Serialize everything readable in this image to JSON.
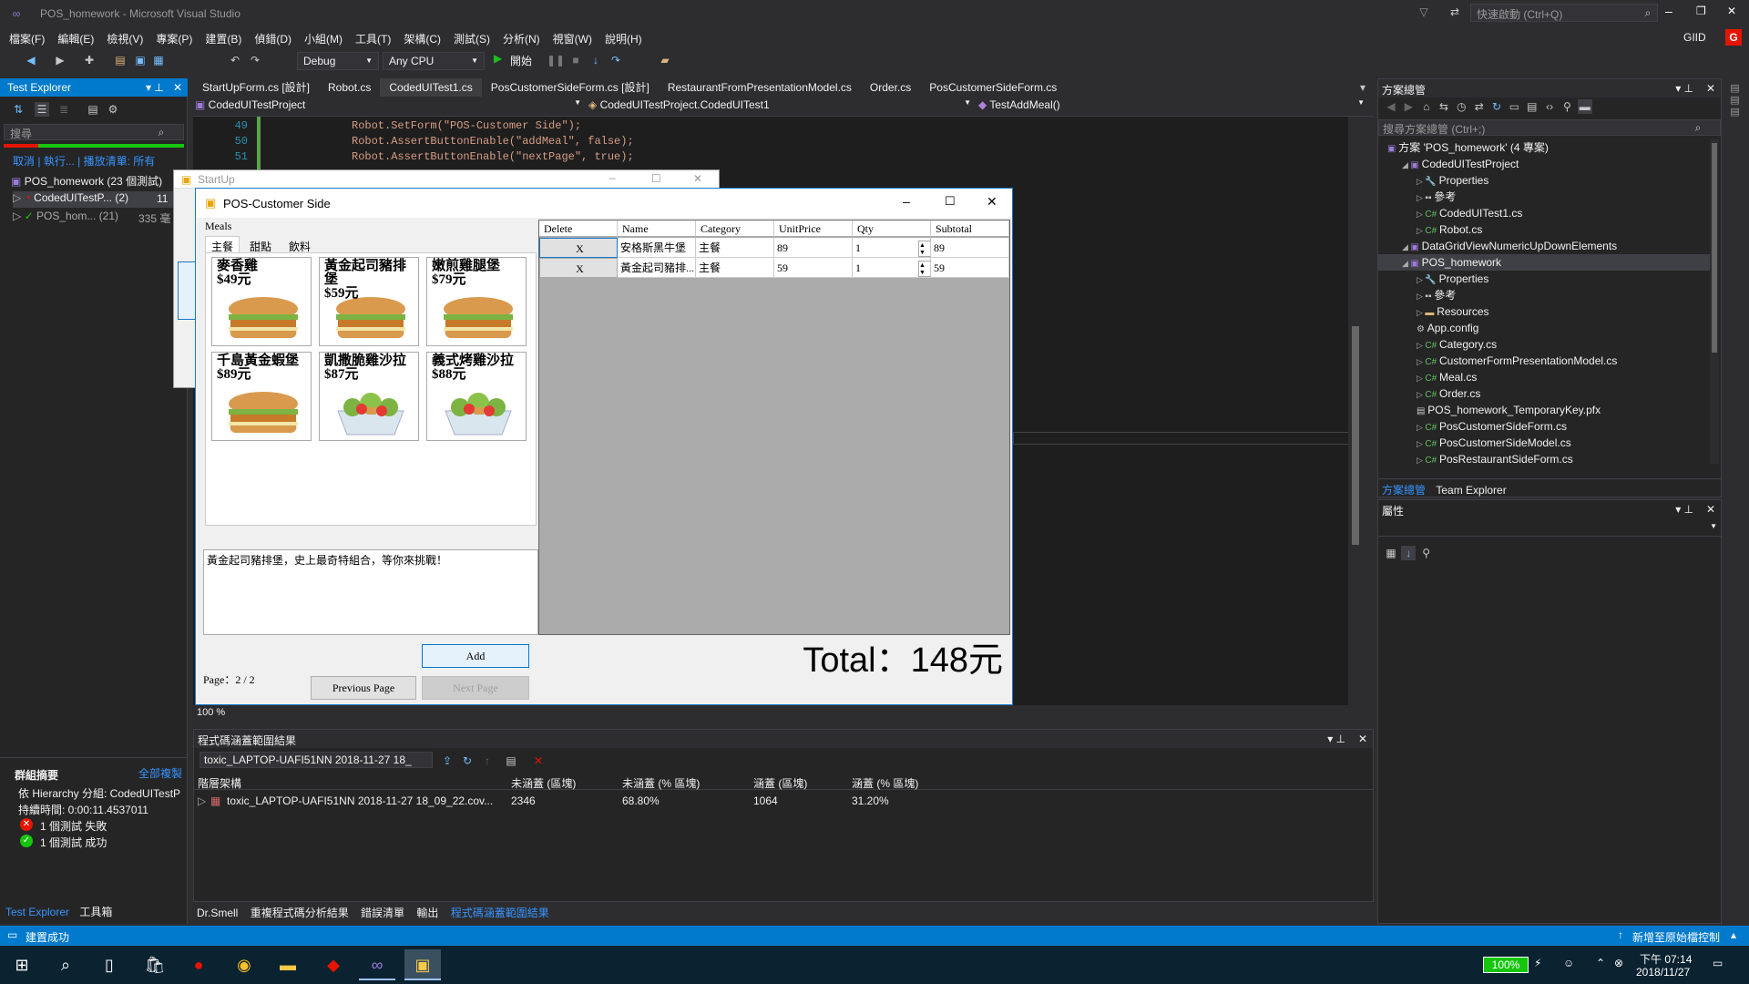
{
  "vs": {
    "title": "POS_homework - Microsoft Visual Studio",
    "quick_launch": "快速啟動 (Ctrl+Q)",
    "user": "GIID",
    "user_initial": "G",
    "menu": [
      "檔案(F)",
      "編輯(E)",
      "檢視(V)",
      "專案(P)",
      "建置(B)",
      "偵錯(D)",
      "小組(M)",
      "工具(T)",
      "架構(C)",
      "測試(S)",
      "分析(N)",
      "視窗(W)",
      "說明(H)"
    ],
    "config": "Debug",
    "platform": "Any CPU",
    "start": "開始"
  },
  "test_explorer": {
    "title": "Test Explorer",
    "search_placeholder": "搜尋",
    "actions": [
      "取消",
      "執行...",
      "播放清單: 所有"
    ],
    "group": "POS_homework (23 個測試)",
    "tests": [
      {
        "name": "CodedUITestP... (2)",
        "count": "11"
      },
      {
        "name": "POS_hom... (21)",
        "count": "335 毫"
      }
    ],
    "summary_title": "群組摘要",
    "copy_all": "全部複製",
    "hierarchy": "依 Hierarchy 分組: CodedUITestP",
    "duration": "持續時間: 0:00:11.4537011",
    "failed": "1 個測試 失敗",
    "passed": "1 個測試 成功",
    "bottom_tabs": [
      "Test Explorer",
      "工具箱"
    ]
  },
  "editor": {
    "tabs": [
      "StartUpForm.cs [設計]",
      "Robot.cs",
      "CodedUITest1.cs",
      "PosCustomerSideForm.cs [設計]",
      "RestaurantFromPresentationModel.cs",
      "Order.cs",
      "PosCustomerSideForm.cs"
    ],
    "nav": [
      "CodedUITestProject",
      "CodedUITestProject.CodedUITest1",
      "TestAddMeal()"
    ],
    "lines": [
      {
        "n": "49",
        "code": "Robot.SetForm(\"POS-Customer Side\");"
      },
      {
        "n": "50",
        "code": "Robot.AssertButtonEnable(\"addMeal\", false);"
      },
      {
        "n": "51",
        "code": "Robot.AssertButtonEnable(\"nextPage\", true);"
      }
    ],
    "zoom": "100 %"
  },
  "coverage": {
    "title": "程式碼涵蓋範圍結果",
    "run": "toxic_LAPTOP-UAFI51NN 2018-11-27 18_",
    "headers": [
      "階層架構",
      "未涵蓋 (區塊)",
      "未涵蓋 (% 區塊)",
      "涵蓋 (區塊)",
      "涵蓋 (% 區塊)"
    ],
    "row": [
      "toxic_LAPTOP-UAFI51NN 2018-11-27 18_09_22.cov...",
      "2346",
      "68.80%",
      "1064",
      "31.20%"
    ]
  },
  "bottom_tabs": [
    "Dr.Smell",
    "重複程式碼分析結果",
    "錯誤清單",
    "輸出",
    "程式碼涵蓋範圍結果"
  ],
  "solution": {
    "title": "方案總管",
    "search": "搜尋方案總管 (Ctrl+;)",
    "items": [
      {
        "label": "方案 'POS_homework' (4 專案)",
        "indent": 0,
        "icon": "solution"
      },
      {
        "label": "CodedUITestProject",
        "indent": 1,
        "icon": "project"
      },
      {
        "label": "Properties",
        "indent": 2,
        "icon": "wrench"
      },
      {
        "label": "參考",
        "indent": 2,
        "icon": "ref"
      },
      {
        "label": "CodedUITest1.cs",
        "indent": 2,
        "icon": "cs"
      },
      {
        "label": "Robot.cs",
        "indent": 2,
        "icon": "cs"
      },
      {
        "label": "DataGridViewNumericUpDownElements",
        "indent": 1,
        "icon": "project"
      },
      {
        "label": "POS_homework",
        "indent": 1,
        "icon": "project",
        "selected": true
      },
      {
        "label": "Properties",
        "indent": 2,
        "icon": "wrench"
      },
      {
        "label": "參考",
        "indent": 2,
        "icon": "ref"
      },
      {
        "label": "Resources",
        "indent": 2,
        "icon": "folder"
      },
      {
        "label": "App.config",
        "indent": 2,
        "icon": "config"
      },
      {
        "label": "Category.cs",
        "indent": 2,
        "icon": "cs"
      },
      {
        "label": "CustomerFormPresentationModel.cs",
        "indent": 2,
        "icon": "cs"
      },
      {
        "label": "Meal.cs",
        "indent": 2,
        "icon": "cs"
      },
      {
        "label": "Order.cs",
        "indent": 2,
        "icon": "cs"
      },
      {
        "label": "POS_homework_TemporaryKey.pfx",
        "indent": 2,
        "icon": "file"
      },
      {
        "label": "PosCustomerSideForm.cs",
        "indent": 2,
        "icon": "cs"
      },
      {
        "label": "PosCustomerSideModel.cs",
        "indent": 2,
        "icon": "cs"
      },
      {
        "label": "PosRestaurantSideForm.cs",
        "indent": 2,
        "icon": "cs"
      }
    ],
    "tabs": [
      "方案總管",
      "Team Explorer"
    ]
  },
  "properties": {
    "title": "屬性"
  },
  "status": {
    "text": "建置成功",
    "right": "新增至原始檔控制"
  },
  "taskbar": {
    "battery": "100%",
    "time": "下午 07:14",
    "date": "2018/11/27"
  },
  "startup": {
    "title": "StartUp"
  },
  "pos": {
    "title": "POS-Customer Side",
    "meals_label": "Meals",
    "tabs": [
      "主餐",
      "甜點",
      "飲料"
    ],
    "meals": [
      {
        "name": "麥香雞",
        "price": "$49元",
        "kind": "burger"
      },
      {
        "name": "黃金起司豬排堡",
        "price": "$59元",
        "kind": "burger"
      },
      {
        "name": "嫩煎雞腿堡",
        "price": "$79元",
        "kind": "burger"
      },
      {
        "name": "千島黃金蝦堡",
        "price": "$89元",
        "kind": "burger"
      },
      {
        "name": "凱撒脆雞沙拉",
        "price": "$87元",
        "kind": "salad"
      },
      {
        "name": "義式烤雞沙拉",
        "price": "$88元",
        "kind": "salad"
      }
    ],
    "description": "黃金起司豬排堡，史上最奇特組合，等你來挑戰！",
    "add": "Add",
    "page": "Page：2 / 2",
    "prev": "Previous Page",
    "next": "Next Page",
    "grid_headers": [
      "Delete",
      "Name",
      "Category",
      "UnitPrice",
      "Qty",
      "Subtotal"
    ],
    "rows": [
      {
        "del": "X",
        "name": "安格斯黑牛堡",
        "cat": "主餐",
        "price": "89",
        "qty": "1",
        "sub": "89"
      },
      {
        "del": "X",
        "name": "黃金起司豬排...",
        "cat": "主餐",
        "price": "59",
        "qty": "1",
        "sub": "59"
      }
    ],
    "total": "Total：148元"
  }
}
